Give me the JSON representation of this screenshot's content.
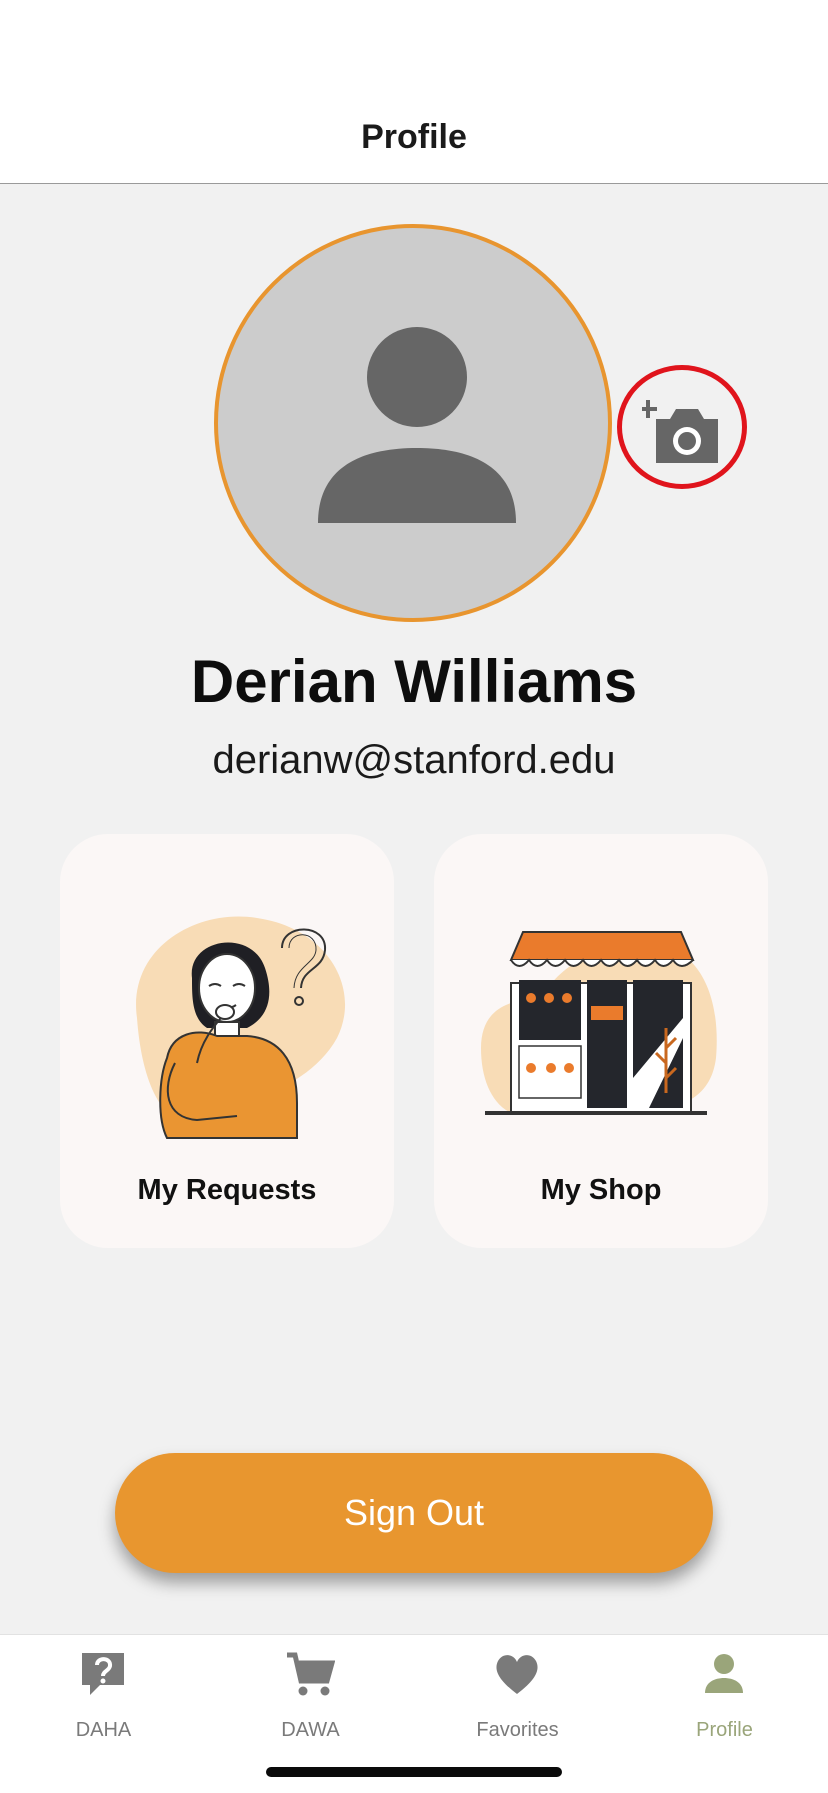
{
  "header": {
    "title": "Profile"
  },
  "profile": {
    "name": "Derian Williams",
    "email": "derianw@stanford.edu"
  },
  "cards": [
    {
      "label": "My Requests",
      "icon": "person-thinking-illustration"
    },
    {
      "label": "My Shop",
      "icon": "storefront-illustration"
    }
  ],
  "signout": {
    "label": "Sign Out"
  },
  "tabs": [
    {
      "label": "DAHA",
      "icon": "question-bubble-icon"
    },
    {
      "label": "DAWA",
      "icon": "cart-icon"
    },
    {
      "label": "Favorites",
      "icon": "heart-icon"
    },
    {
      "label": "Profile",
      "icon": "person-icon",
      "active": true
    }
  ],
  "colors": {
    "accent": "#e8952f",
    "highlight_ring": "#e0141c",
    "active_tab": "#9aa57a",
    "inactive_tab": "#7a7a7a"
  }
}
